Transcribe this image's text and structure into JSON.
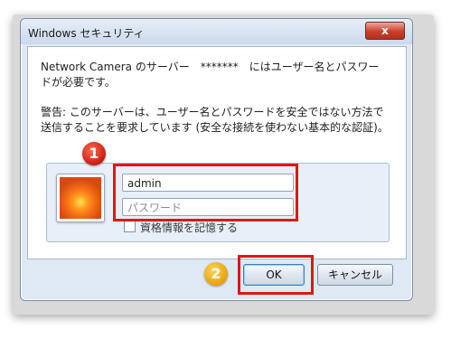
{
  "window": {
    "title": "Windows セキュリティ",
    "close_label": "x"
  },
  "message": {
    "line1": "Network Camera のサーバー　*******　にはユーザー名とパスワー",
    "line2": "ドが必要です。",
    "warning_line1": "警告: このサーバーは、ユーザー名とパスワードを安全ではない方法で",
    "warning_line2": "送信することを要求しています (安全な接続を使わない基本的な認証)。"
  },
  "credentials": {
    "username_value": "admin",
    "password_placeholder": "パスワード",
    "remember_label": "資格情報を記憶する",
    "remember_checked": false
  },
  "buttons": {
    "ok_label": "OK",
    "cancel_label": "キャンセル"
  },
  "annotations": {
    "badge1": "1",
    "badge2": "2",
    "highlight_color": "#e01616",
    "badge1_color": "#d9261a",
    "badge2_color": "#f0a81a"
  }
}
